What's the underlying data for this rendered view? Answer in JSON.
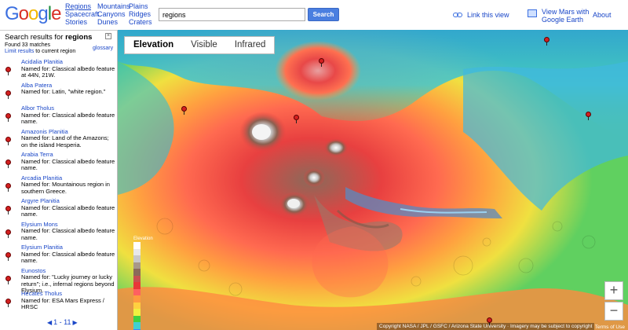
{
  "header": {
    "nav_col1": [
      "Regions",
      "Spacecraft",
      "Stories"
    ],
    "nav_col2": [
      "Mountains",
      "Canyons",
      "Dunes"
    ],
    "nav_col3": [
      "Plains",
      "Ridges",
      "Craters"
    ],
    "search_value": "regions",
    "search_button": "Search",
    "link_view": "Link this view",
    "earth_line1": "View Mars with",
    "earth_line2": "Google Earth",
    "about": "About"
  },
  "sidebar": {
    "title_prefix": "Search results for",
    "query": "regions",
    "found": "Found 33 matches",
    "limit": "Limit results",
    "limit_suffix": " to current region",
    "glossary": "glossary",
    "results": [
      {
        "title": "Acidalia Planitia",
        "desc": "Named for: Classical albedo feature at 44N, 21W."
      },
      {
        "title": "Alba Patera",
        "desc": "Named for: Latin, \"white region.\""
      },
      {
        "title": "Albor Tholus",
        "desc": "Named for: Classical albedo feature name."
      },
      {
        "title": "Amazonis Planitia",
        "desc": "Named for: Land of the Amazons; on the island Hesperia."
      },
      {
        "title": "Arabia Terra",
        "desc": "Named for: Classical albedo feature name."
      },
      {
        "title": "Arcadia Planitia",
        "desc": "Named for: Mountainous region in southern Greece."
      },
      {
        "title": "Argyre Planitia",
        "desc": "Named for: Classical albedo feature name."
      },
      {
        "title": "Elysium Mons",
        "desc": "Named for: Classical albedo feature name."
      },
      {
        "title": "Elysium Planitia",
        "desc": "Named for: Classical albedo feature name."
      },
      {
        "title": "Eunostos",
        "desc": "Named for: \"Lucky journey or lucky return\"; i.e., infernal regions beyond Elysium."
      },
      {
        "title": "Hecates Tholus",
        "desc": "Named for: ESA Mars Express / HRSC"
      }
    ],
    "pager": "1 - 11"
  },
  "map": {
    "tabs": [
      "Elevation",
      "Visible",
      "Infrared"
    ],
    "active_tab": "Elevation",
    "legend_title": "Elevation",
    "legend_colors": [
      "#ffffff",
      "#e8e8e8",
      "#c8c8c8",
      "#a89888",
      "#8a6a5a",
      "#c85050",
      "#e83838",
      "#ff6060",
      "#ff9a40",
      "#ffd040",
      "#f0f040",
      "#40d040",
      "#40d0d0",
      "#4080ff",
      "#4040d0"
    ],
    "zoom_in": "+",
    "zoom_out": "−",
    "credits": "Copyright NASA / JPL / GSFC / Arizona State University · Imagery may be subject to copyright",
    "terms": "Terms of Use"
  }
}
